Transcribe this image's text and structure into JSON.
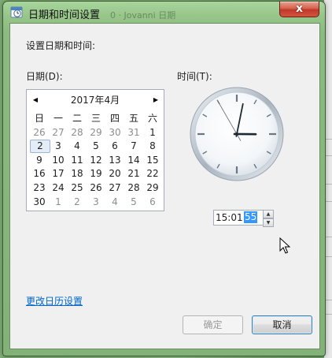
{
  "window": {
    "title": "日期和时间设置",
    "ghost_title": "0 · Jovanni  日期",
    "close_glyph": "x"
  },
  "labels": {
    "set_datetime": "设置日期和时间:",
    "date": "日期(D):",
    "time": "时间(T):"
  },
  "calendar": {
    "month_label": "2017年4月",
    "prev_glyph": "◀",
    "next_glyph": "▶",
    "weekdays": [
      "日",
      "一",
      "二",
      "三",
      "四",
      "五",
      "六"
    ],
    "weeks": [
      [
        "26",
        "27",
        "28",
        "29",
        "30",
        "31",
        "1"
      ],
      [
        "2",
        "3",
        "4",
        "5",
        "6",
        "7",
        "8"
      ],
      [
        "9",
        "10",
        "11",
        "12",
        "13",
        "14",
        "15"
      ],
      [
        "16",
        "17",
        "18",
        "19",
        "20",
        "21",
        "22"
      ],
      [
        "23",
        "24",
        "25",
        "26",
        "27",
        "28",
        "29"
      ],
      [
        "30",
        "1",
        "2",
        "3",
        "4",
        "5",
        "6"
      ]
    ],
    "selected_day": "2"
  },
  "clock": {
    "hour": 15,
    "minute": 1,
    "second": 55
  },
  "time_field": {
    "hhmm": "15:01:",
    "seconds": "55"
  },
  "link": {
    "change_calendar": "更改日历设置"
  },
  "buttons": {
    "ok": "确定",
    "cancel": "取消"
  }
}
